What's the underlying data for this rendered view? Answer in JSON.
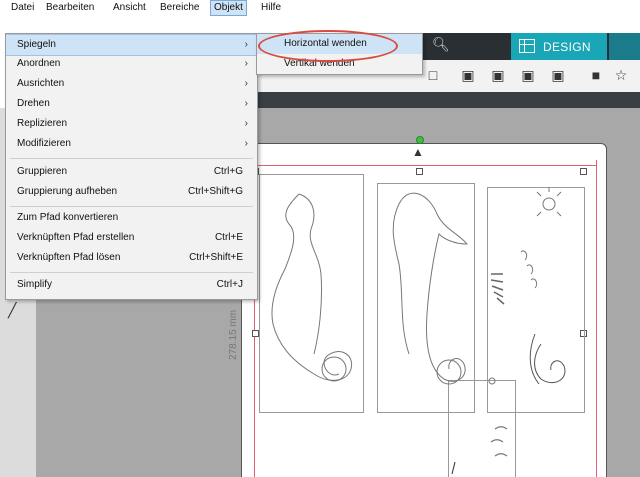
{
  "menubar": {
    "items": [
      "Datei",
      "Bearbeiten",
      "Ansicht",
      "Bereiche",
      "Objekt",
      "Hilfe"
    ]
  },
  "menu": {
    "items": [
      {
        "label": "Spiegeln",
        "submenu": true
      },
      {
        "label": "Anordnen",
        "submenu": true
      },
      {
        "label": "Ausrichten",
        "submenu": true
      },
      {
        "label": "Drehen",
        "submenu": true
      },
      {
        "label": "Replizieren",
        "submenu": true
      },
      {
        "label": "Modifizieren",
        "submenu": true
      },
      {
        "label": "Gruppieren",
        "shortcut": "Ctrl+G"
      },
      {
        "label": "Gruppierung aufheben",
        "shortcut": "Ctrl+Shift+G"
      },
      {
        "label": "Zum Pfad konvertieren"
      },
      {
        "label": "Verknüpften Pfad erstellen",
        "shortcut": "Ctrl+E"
      },
      {
        "label": "Verknüpften Pfad lösen",
        "shortcut": "Ctrl+Shift+E"
      },
      {
        "label": "Simplify",
        "shortcut": "Ctrl+J"
      }
    ]
  },
  "submenu": {
    "items": [
      "Horizontal wenden",
      "Vertikal wenden"
    ]
  },
  "toolbar": {
    "design_label": "DESIGN"
  },
  "canvas": {
    "dimension_label": "278.15 mm"
  },
  "colors": {
    "design_tab": "#19a6b6",
    "highlight": "#cfe3f6",
    "annotation": "#d94b40",
    "cut_line": "#e06070"
  },
  "icons": [
    "zoom-icon",
    "design-grid-icon",
    "arrow-up-icon",
    "pen-icon",
    "chevron-right-icon",
    "star-icon"
  ]
}
